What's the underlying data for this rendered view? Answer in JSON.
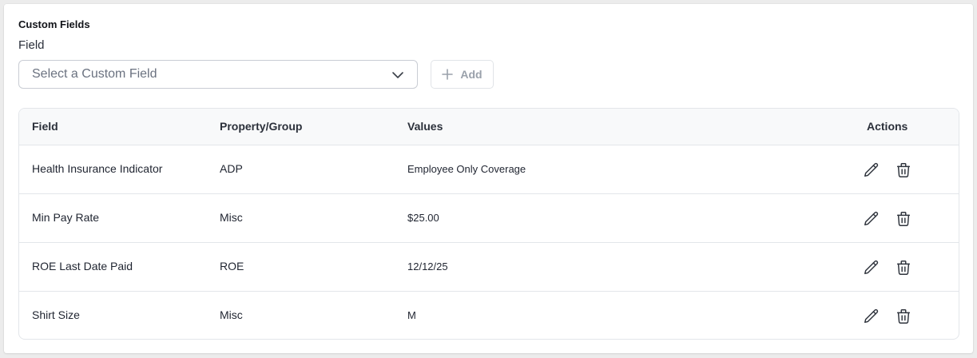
{
  "section": {
    "title": "Custom Fields",
    "field_label": "Field"
  },
  "select": {
    "placeholder": "Select a Custom Field",
    "icon": "chevron-down-icon"
  },
  "add_button": {
    "label": "Add",
    "icon": "plus-icon"
  },
  "table": {
    "headers": {
      "field": "Field",
      "property": "Property/Group",
      "values": "Values",
      "actions": "Actions"
    },
    "rows": [
      {
        "field": "Health Insurance Indicator",
        "property": "ADP",
        "value": "Employee Only Coverage"
      },
      {
        "field": "Min Pay Rate",
        "property": "Misc",
        "value": "$25.00"
      },
      {
        "field": "ROE Last Date Paid",
        "property": "ROE",
        "value": "12/12/25"
      },
      {
        "field": "Shirt Size",
        "property": "Misc",
        "value": "M"
      }
    ],
    "row_actions": [
      "pencil-icon",
      "trash-icon"
    ]
  },
  "colors": {
    "card_bg": "#ffffff",
    "page_bg": "#ececec",
    "header_bg": "#f8f9fa",
    "border": "#e3e6ea",
    "muted_text": "#9aa1ab"
  }
}
